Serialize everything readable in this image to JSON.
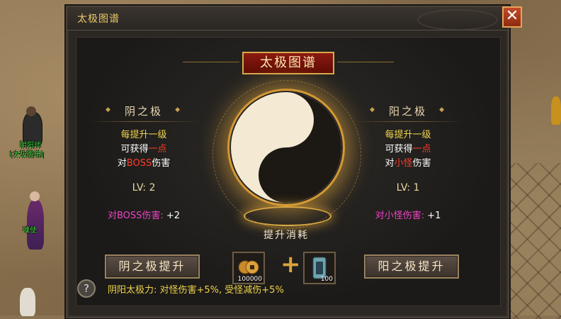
{
  "window": {
    "title": "太极图谱",
    "close_label": "✕",
    "heading": "太极图谱"
  },
  "world": {
    "npcs": [
      {
        "label": "阴阳师"
      },
      {
        "label": "[太极图谱]"
      },
      {
        "label": "魂使"
      }
    ]
  },
  "yin": {
    "title": "阴之极",
    "line1": "每提升一级",
    "line2_prefix": "可获得",
    "line2_highlight": "一点",
    "line3_prefix": "对",
    "line3_highlight": "BOSS",
    "line3_suffix": "伤害",
    "level": "LV: 2",
    "damage_label": "对BOSS伤害:",
    "damage_value": "+2",
    "button": "阴之极提升"
  },
  "yang": {
    "title": "阳之极",
    "line1": "每提升一级",
    "line2_prefix": "可获得",
    "line2_highlight": "一点",
    "line3_prefix": "对",
    "line3_highlight": "小怪",
    "line3_suffix": "伤害",
    "level": "LV: 1",
    "damage_label": "对小怪伤害:",
    "damage_value": "+1",
    "button": "阳之极提升"
  },
  "cost": {
    "label": "提升消耗",
    "items": [
      {
        "icon": "gold-coins-icon",
        "quantity": "100000"
      },
      {
        "icon": "jade-token-icon",
        "quantity": "100"
      }
    ],
    "plus": "+"
  },
  "footer": {
    "help": "?",
    "summary": "阴阳太极力: 对怪伤害+5%, 受怪减伤+5%"
  },
  "colors": {
    "gold_text": "#f0d44c",
    "highlight_red": "#ff3c2a",
    "damage_pink": "#ee44c8",
    "close_button": "#c24b28"
  }
}
